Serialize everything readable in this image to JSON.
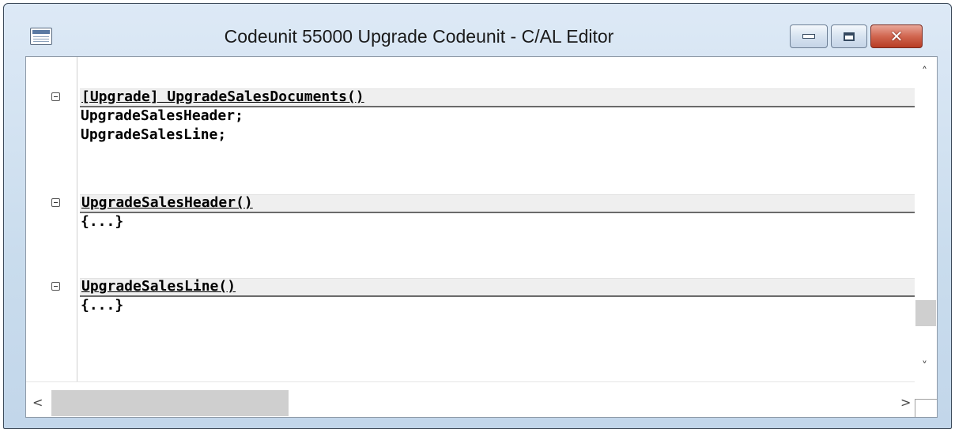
{
  "window": {
    "title": "Codeunit 55000 Upgrade Codeunit - C/AL Editor",
    "controls": {
      "minimize": "minimize",
      "maximize": "maximize",
      "close": "✕"
    }
  },
  "editor": {
    "procedures": [
      {
        "header": "[Upgrade] UpgradeSalesDocuments()",
        "body": [
          "UpgradeSalesHeader;",
          "UpgradeSalesLine;"
        ]
      },
      {
        "header": "UpgradeSalesHeader()",
        "body": [
          "{...}"
        ]
      },
      {
        "header": "UpgradeSalesLine()",
        "body": [
          "{...}"
        ]
      }
    ]
  },
  "scrollbars": {
    "up_arrow": "˄",
    "down_arrow": "˅",
    "left_arrow": "<",
    "right_arrow": ">"
  },
  "icons": {
    "system_menu": "window-icon",
    "collapse": "collapse-icon"
  }
}
